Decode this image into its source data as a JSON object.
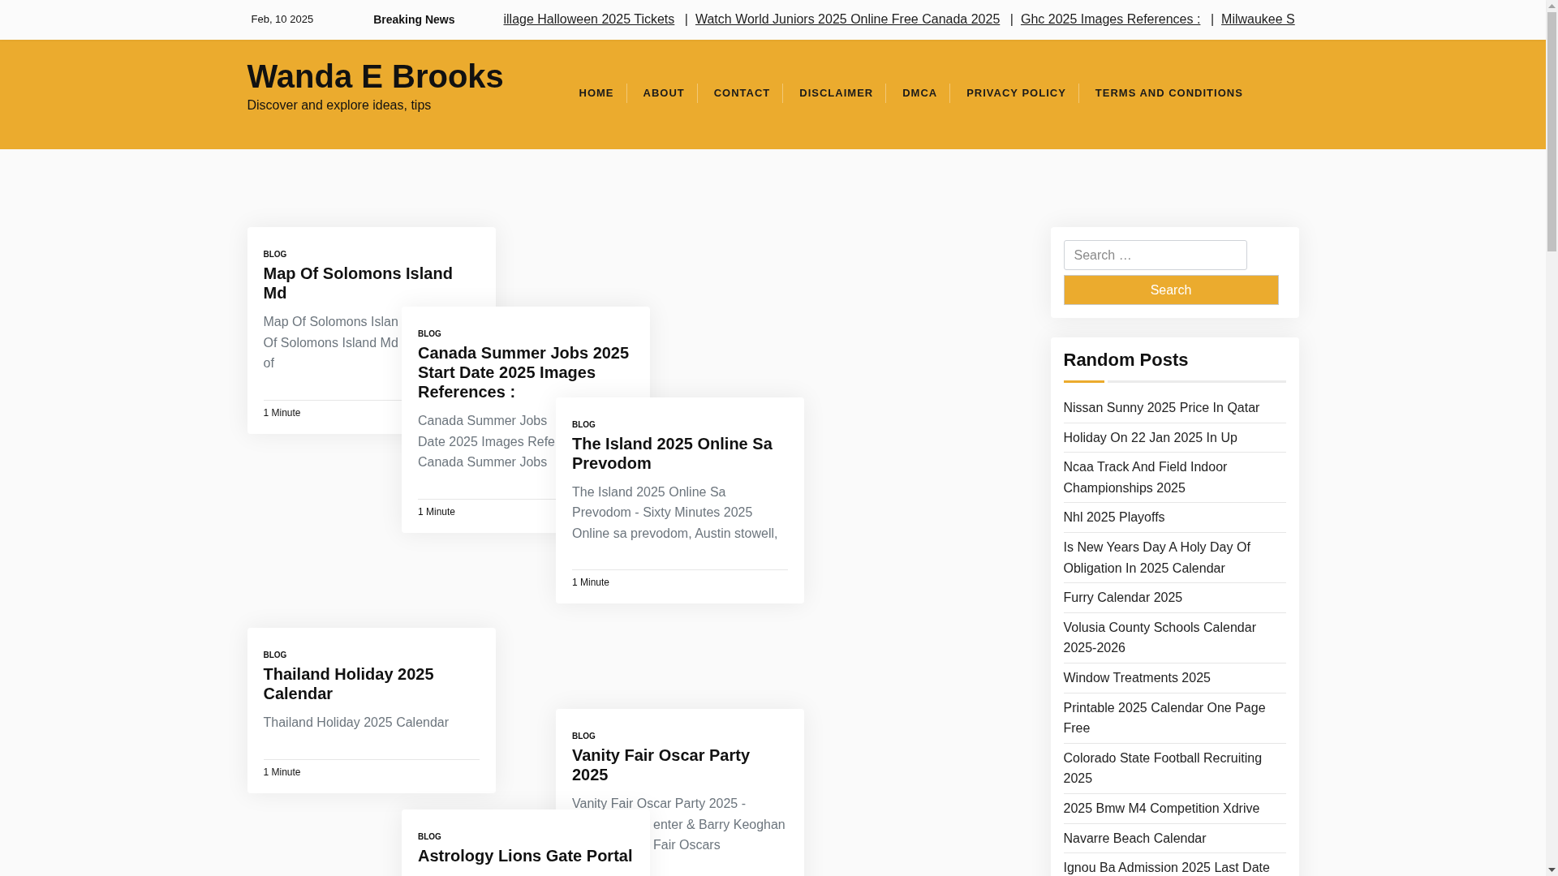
{
  "top_bar": {
    "date": "Feb, 10 2025",
    "breaking_label": "Breaking News",
    "ticker": [
      {
        "kind": "link",
        "text": "illage Halloween 2025 Tickets"
      },
      {
        "kind": "separator",
        "text": "|"
      },
      {
        "kind": "link",
        "text": "Watch World Juniors 2025 Online Free Canada 2025"
      },
      {
        "kind": "separator",
        "text": "|"
      },
      {
        "kind": "link",
        "text": "Ghc 2025 Images References :"
      },
      {
        "kind": "separator",
        "text": "|"
      },
      {
        "kind": "link",
        "text": "Milwaukee S"
      }
    ]
  },
  "header": {
    "site_title": "Wanda E Brooks",
    "tagline": "Discover and explore ideas, tips",
    "nav": [
      "HOME",
      "ABOUT",
      "CONTACT",
      "DISCLAIMER",
      "DMCA",
      "PRIVACY POLICY",
      "TERMS AND CONDITIONS"
    ]
  },
  "posts": [
    {
      "category": "BLOG",
      "title": "Map Of Solomons Island Md",
      "excerpt_lines": [
        "Map Of Solomons Islan",
        "Of Solomons Island Md",
        "of"
      ],
      "reading_time": "1 Minute"
    },
    {
      "category": "BLOG",
      "title": "Canada Summer Jobs 2025 Start Date 2025 Images References :",
      "excerpt_lines": [
        "Canada Summer Jobs",
        "Date 2025 Images Refe",
        "Canada Summer Jobs"
      ],
      "reading_time": "1 Minute"
    },
    {
      "category": "BLOG",
      "title": "The Island 2025 Online Sa Prevodom",
      "excerpt_lines": [
        "The Island 2025 Online Sa",
        "Prevodom - Sixty Minutes 2025",
        "Online sa prevodom, Austin stowell,"
      ],
      "reading_time": "1 Minute"
    },
    {
      "category": "BLOG",
      "title": "Thailand Holiday 2025 Calendar",
      "excerpt_lines": [
        "Thailand Holiday 2025 Calendar"
      ],
      "reading_time": "1 Minute"
    },
    {
      "category": "BLOG",
      "title": "Vanity Fair Oscar Party 2025",
      "excerpt_lines": [
        "Vanity Fair Oscar Party 2025 -",
        "enter & Barry Keoghan",
        "Fair Oscars"
      ]
    },
    {
      "category": "BLOG",
      "title": "Astrology Lions Gate Portal"
    }
  ],
  "sidebar": {
    "search": {
      "placeholder": "Search …",
      "button": "Search"
    },
    "random_posts": {
      "title": "Random Posts",
      "items": [
        "Nissan Sunny 2025 Price In Qatar",
        "Holiday On 22 Jan 2025 In Up",
        "Ncaa Track And Field Indoor Championships 2025",
        "Nhl 2025 Playoffs",
        "Is New Years Day A Holy Day Of Obligation In 2025 Calendar",
        "Furry Calendar 2025",
        "Volusia County Schools Calendar 2025-2026",
        "Window Treatments 2025",
        "Printable 2025 Calendar One Page Free",
        "Colorado State Football Recruiting 2025",
        "2025 Bmw M4 Competition Xdrive",
        "Navarre Beach Calendar",
        "Ignou Ba Admission 2025 Last Date"
      ]
    }
  }
}
